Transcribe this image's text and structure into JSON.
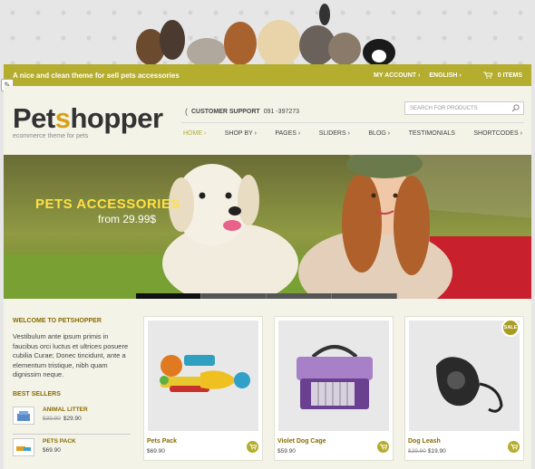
{
  "topbar": {
    "tagline": "A nice and clean theme for sell pets accessories",
    "my_account": "MY ACCOUNT",
    "language": "ENGLISH",
    "cart": "0 ITEMS"
  },
  "header": {
    "logo_main_1": "Pet",
    "logo_main_accent": "s",
    "logo_main_2": "hopper",
    "logo_sub": "ecommerce theme for pets",
    "support_label": "CUSTOMER SUPPORT",
    "support_phone": "091 -397273",
    "search_placeholder": "SEARCH FOR PRODUCTS"
  },
  "nav": [
    {
      "label": "HOME",
      "caret": "›",
      "active": true
    },
    {
      "label": "SHOP BY",
      "caret": "›"
    },
    {
      "label": "PAGES",
      "caret": "›"
    },
    {
      "label": "SLIDERS",
      "caret": "›"
    },
    {
      "label": "BLOG",
      "caret": "›"
    },
    {
      "label": "TESTIMONIALS",
      "caret": ""
    },
    {
      "label": "SHORTCODES",
      "caret": "›"
    }
  ],
  "hero": {
    "title": "PETS ACCESSORIES",
    "price": "from 29.99$"
  },
  "sidebar": {
    "welcome_title": "WELCOME TO PETSHOPPER",
    "welcome_text": "Vestibulum ante ipsum primis in faucibus orci luctus et ultrices posuere cubilia Curae; Donec tincidunt, ante a elementum tristique, nibh quam dignissim neque.",
    "best_sellers_title": "BEST SELLERS",
    "best_sellers": [
      {
        "name": "ANIMAL LITTER",
        "old_price": "$39.90",
        "price": "$29.90"
      },
      {
        "name": "PETS PACK",
        "old_price": "",
        "price": "$69.90"
      }
    ]
  },
  "products": [
    {
      "name": "Pets Pack",
      "old_price": "",
      "price": "$69.90",
      "sale": ""
    },
    {
      "name": "Violet Dog Cage",
      "old_price": "",
      "price": "$59.90",
      "sale": ""
    },
    {
      "name": "Dog Leash",
      "old_price": "$29.90",
      "price": "$19.90",
      "sale": "SALE"
    }
  ],
  "colors": {
    "accent": "#b4ad2e",
    "title_gold": "#8a6b00",
    "hero_title": "#ffe046"
  }
}
